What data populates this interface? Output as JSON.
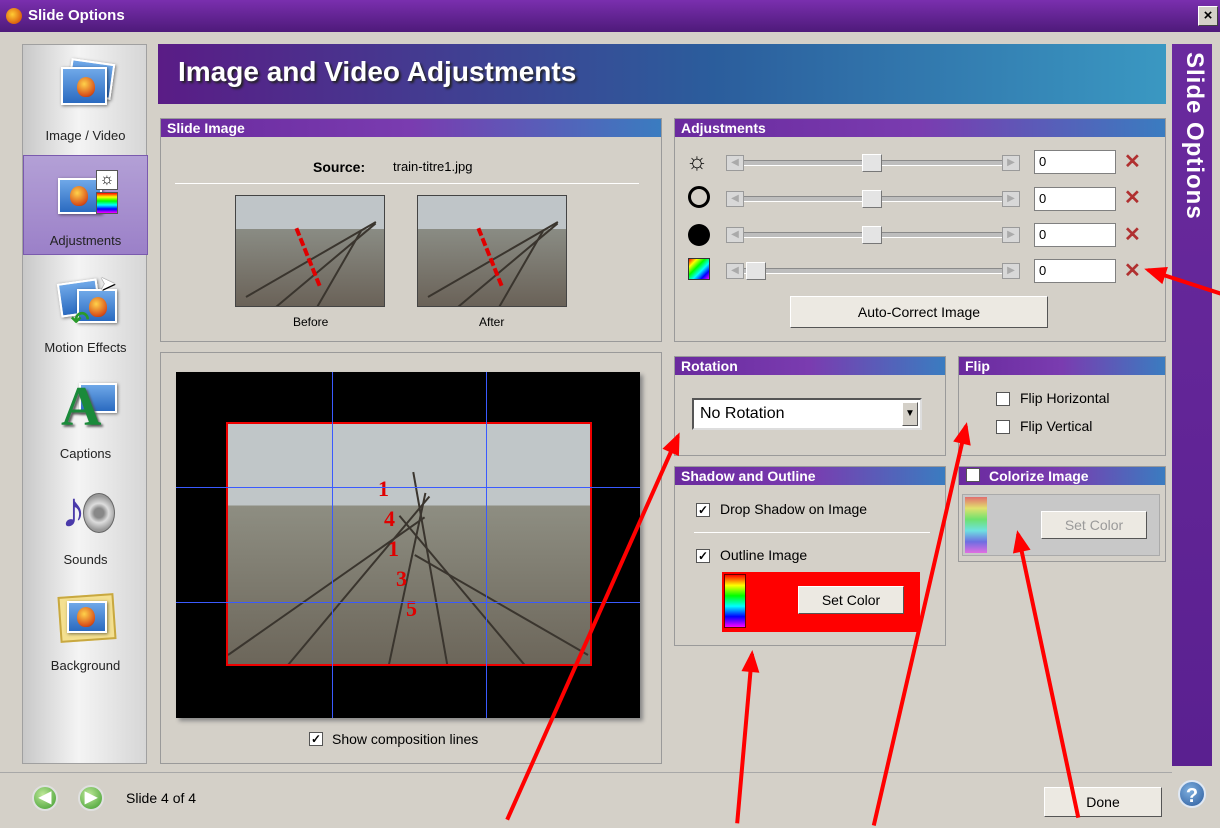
{
  "window": {
    "title": "Slide Options",
    "close_label": "×"
  },
  "header": {
    "title": "Image and Video Adjustments"
  },
  "side_tab": {
    "label": "Slide Options"
  },
  "nav": {
    "items": [
      {
        "label": "Image / Video",
        "active": false
      },
      {
        "label": "Adjustments",
        "active": true
      },
      {
        "label": "Motion Effects",
        "active": false
      },
      {
        "label": "Captions",
        "active": false
      },
      {
        "label": "Sounds",
        "active": false
      },
      {
        "label": "Background",
        "active": false
      }
    ]
  },
  "slide_image": {
    "title": "Slide Image",
    "source_label": "Source:",
    "source_file": "train-titre1.jpg",
    "before_label": "Before",
    "after_label": "After"
  },
  "adjustments": {
    "title": "Adjustments",
    "rows": [
      {
        "icon": "brightness-icon",
        "value": "0",
        "level": 0.5
      },
      {
        "icon": "contrast-icon",
        "value": "0",
        "level": 0.5
      },
      {
        "icon": "darkness-icon",
        "value": "0",
        "level": 0.5
      },
      {
        "icon": "color-icon",
        "value": "0",
        "level": 0.0
      }
    ],
    "auto_correct_label": "Auto-Correct Image"
  },
  "rotation": {
    "title": "Rotation",
    "selected": "No Rotation"
  },
  "flip": {
    "title": "Flip",
    "horizontal_label": "Flip Horizontal",
    "horizontal_checked": false,
    "vertical_label": "Flip Vertical",
    "vertical_checked": false
  },
  "shadow": {
    "title": "Shadow and Outline",
    "drop_shadow_label": "Drop Shadow on Image",
    "drop_shadow_checked": true,
    "outline_label": "Outline Image",
    "outline_checked": true,
    "set_color_label": "Set Color",
    "outline_color": "#ff0000"
  },
  "colorize": {
    "title": "Colorize Image",
    "checked": false,
    "set_color_label": "Set Color"
  },
  "composition": {
    "show_lines_label": "Show composition lines",
    "show_lines_checked": true,
    "numbers": [
      "1",
      "4",
      "1",
      "3",
      "5"
    ]
  },
  "footer": {
    "slide_status": "Slide 4 of 4",
    "done_label": "Done",
    "help_label": "?"
  },
  "colors": {
    "accent_purple": "#6a2a9e",
    "header_blue": "#3a98c2",
    "annotation_red": "#ff0000"
  }
}
